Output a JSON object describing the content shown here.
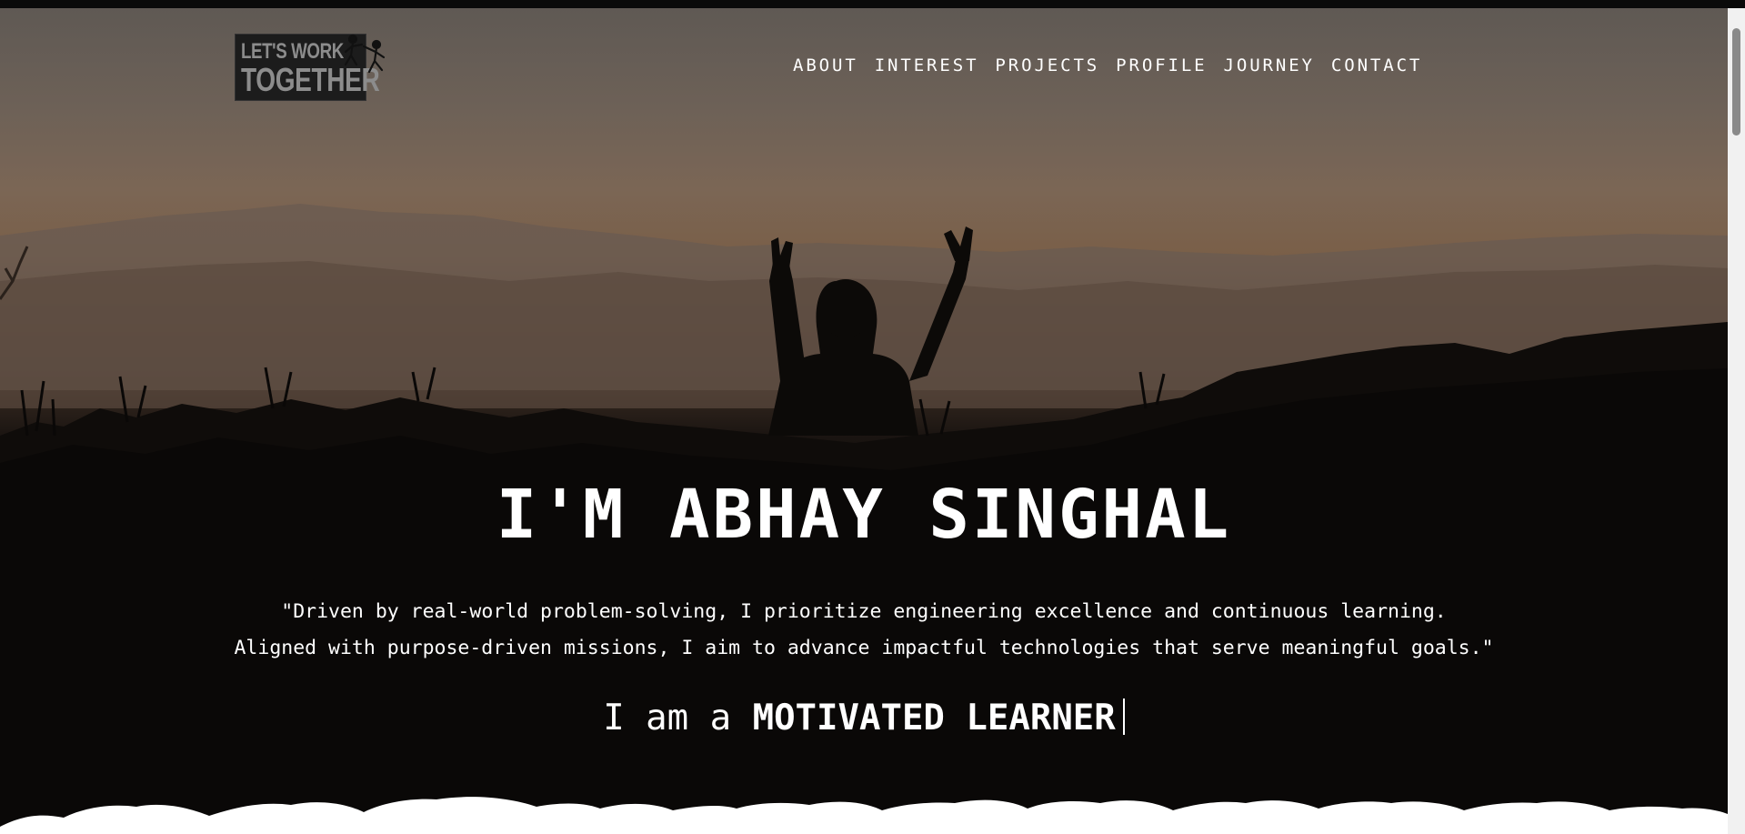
{
  "logo": {
    "line1": "LET'S WORK",
    "line2": "TOGETHER"
  },
  "nav": [
    "ABOUT",
    "INTEREST",
    "PROJECTS",
    "PROFILE",
    "JOURNEY",
    "CONTACT"
  ],
  "hero": {
    "title": "I'M ABHAY SINGHAL",
    "quote_line1": "\"Driven by real-world problem-solving, I prioritize engineering excellence and continuous learning.",
    "quote_line2": "Aligned with purpose-driven missions, I aim to advance impactful technologies that serve meaningful goals.\"",
    "typed_prefix": "I am a",
    "typed_word": "MOTIVATED LEARNER"
  },
  "colors": {
    "text": "#ffffff",
    "sky_top": "#5f5954",
    "sunset": "#7b6655",
    "ground": "#070606"
  }
}
